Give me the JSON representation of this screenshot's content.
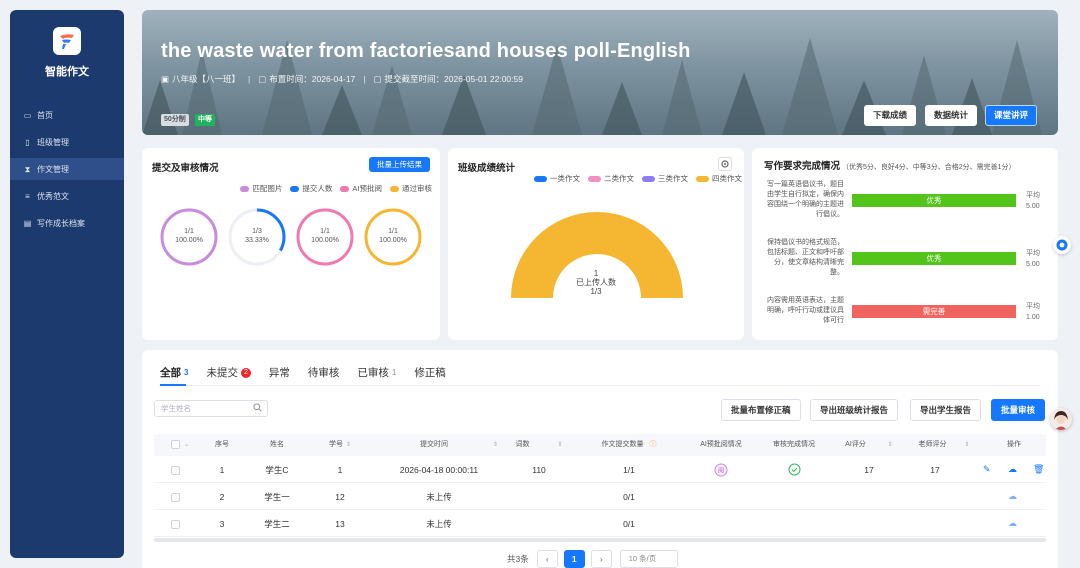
{
  "app": {
    "name": "智能作文"
  },
  "sidebar": {
    "items": [
      {
        "label": "首页",
        "icon": "monitor-icon"
      },
      {
        "label": "班级管理",
        "icon": "document-icon"
      },
      {
        "label": "作文管理",
        "icon": "hourglass-icon",
        "active": true
      },
      {
        "label": "优秀范文",
        "icon": "list-icon"
      },
      {
        "label": "写作成长档案",
        "icon": "folder-icon"
      }
    ]
  },
  "hero": {
    "title": "the waste water from factoriesand houses poll-English",
    "class_name": "八年级【八一班】",
    "assign_time": "布置时间：2026-04-17",
    "deadline": "提交截至时间：2026-05-01 22:00:59",
    "tag_score": "50分制",
    "tag_level": "中等",
    "buttons": {
      "download": "下载成绩",
      "stats": "数据统计",
      "lecture": "课堂讲评"
    }
  },
  "submission": {
    "title": "提交及审核情况",
    "batch_upload": "批量上传结果",
    "legend": [
      {
        "label": "匹配图片",
        "color": "#c98bdb"
      },
      {
        "label": "提交人数",
        "color": "#1677ff"
      },
      {
        "label": "AI预批阅",
        "color": "#f07ab0"
      },
      {
        "label": "通过审核",
        "color": "#f5b631"
      }
    ],
    "rings": [
      {
        "line1": "1/1",
        "line2": "100.00%",
        "fraction": 1.0,
        "color": "#c98bdb"
      },
      {
        "line1": "1/3",
        "line2": "33.33%",
        "fraction": 0.3333,
        "color": "#1677ff"
      },
      {
        "line1": "1/1",
        "line2": "100.00%",
        "fraction": 1.0,
        "color": "#f07ab0"
      },
      {
        "line1": "1/1",
        "line2": "100.00%",
        "fraction": 1.0,
        "color": "#f5b631"
      }
    ]
  },
  "scores": {
    "title": "班级成绩统计",
    "legend": [
      {
        "label": "一类作文",
        "color": "#1677ff"
      },
      {
        "label": "二类作文",
        "color": "#f08fc0"
      },
      {
        "label": "三类作文",
        "color": "#8e7cf0"
      },
      {
        "label": "四类作文",
        "color": "#f5b631"
      }
    ],
    "center_count": "1",
    "center_label": "已上传人数",
    "center_fraction": "1/3",
    "gauge_color": "#f5b631"
  },
  "requirements": {
    "title": "写作要求完成情况",
    "subtitle": "（优秀5分、良好4分、中等3分、合格2分、需完善1分）",
    "avg_label": "平均",
    "items": [
      {
        "text": "写一篇英语倡议书，题目由学生自行拟定，确保内容围绕一个明确的主题进行倡议。",
        "rating": "优秀",
        "avg": "5.00",
        "color": "#52c41a"
      },
      {
        "text": "保持倡议书的格式规范，包括标题、正文和呼吁部分，使文章结构清晰完整。",
        "rating": "优秀",
        "avg": "5.00",
        "color": "#52c41a"
      },
      {
        "text": "内容需用英语表达，主题明确，呼吁行动或建议具体可行",
        "rating": "需完善",
        "avg": "1.00",
        "color": "#f0645f"
      }
    ]
  },
  "tabs": [
    {
      "label": "全部",
      "count": "3",
      "active": true
    },
    {
      "label": "未提交",
      "badge": "2"
    },
    {
      "label": "异常"
    },
    {
      "label": "待审核"
    },
    {
      "label": "已审核",
      "count": "1"
    },
    {
      "label": "修正稿"
    }
  ],
  "toolbar": {
    "search_placeholder": "学生姓名",
    "batch_revise": "批量布置修正稿",
    "export_class": "导出班级统计报告",
    "export_student": "导出学生报告",
    "batch_review": "批量审核"
  },
  "table": {
    "headers": [
      "序号",
      "姓名",
      "学号",
      "提交时间",
      "词数",
      "作文提交数量",
      "AI预批阅情况",
      "审核完成情况",
      "AI评分",
      "老师评分",
      "操作"
    ],
    "rows": [
      {
        "index": "1",
        "name": "学生C",
        "id": "1",
        "time": "2026-04-18 00:00:11",
        "words": "110",
        "count": "1/1",
        "ai_score": "17",
        "teacher_score": "17"
      },
      {
        "index": "2",
        "name": "学生一",
        "id": "12",
        "time": "未上传",
        "words": "",
        "count": "0/1",
        "ai_score": "",
        "teacher_score": ""
      },
      {
        "index": "3",
        "name": "学生二",
        "id": "13",
        "time": "未上传",
        "words": "",
        "count": "0/1",
        "ai_score": "",
        "teacher_score": ""
      }
    ]
  },
  "pagination": {
    "total": "共3条",
    "current": "1",
    "page_size": "10 条/页"
  }
}
